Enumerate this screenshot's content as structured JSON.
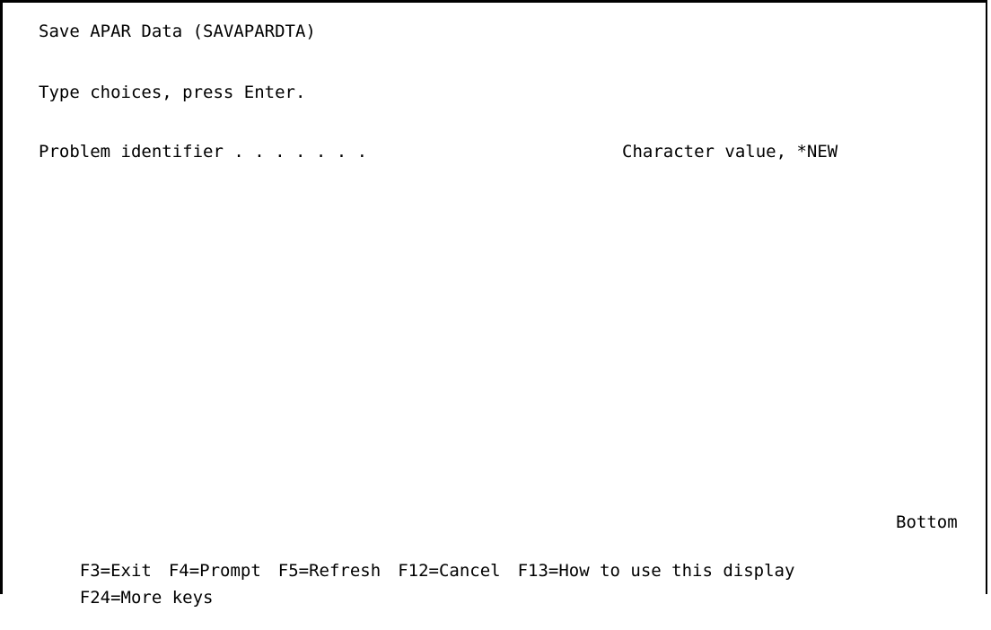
{
  "screen": {
    "title": "Save APAR Data (SAVAPARDTA)",
    "instruction": "Type choices, press Enter."
  },
  "fields": {
    "problem_identifier": {
      "label": "Problem identifier . . . . . . .",
      "value": "",
      "hint": "Character value, *NEW"
    }
  },
  "status": {
    "position": "Bottom"
  },
  "function_keys": {
    "row1": [
      "F3=Exit",
      "F4=Prompt",
      "F5=Refresh",
      "F12=Cancel",
      "F13=How to use this display"
    ],
    "row2": [
      "F24=More keys"
    ]
  }
}
